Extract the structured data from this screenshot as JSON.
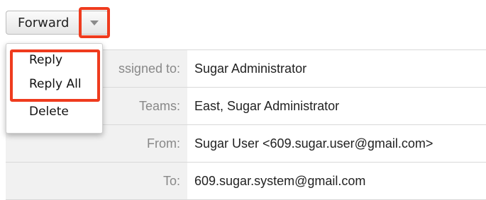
{
  "toolbar": {
    "forward_label": "Forward",
    "dropdown_icon": "caret-down-icon"
  },
  "menu": {
    "items": [
      "Reply",
      "Reply All",
      "Delete"
    ]
  },
  "details": {
    "rows": [
      {
        "label": "ssigned to:",
        "value": "Sugar Administrator"
      },
      {
        "label": "Teams:",
        "value": "East, Sugar Administrator"
      },
      {
        "label": "From:",
        "value": "Sugar User <609.sugar.user@gmail.com>"
      },
      {
        "label": "To:",
        "value": "609.sugar.system@gmail.com"
      }
    ]
  },
  "colors": {
    "highlight": "#ef3b1e",
    "label_bg": "#f1f1f1",
    "label_text": "#888888"
  }
}
